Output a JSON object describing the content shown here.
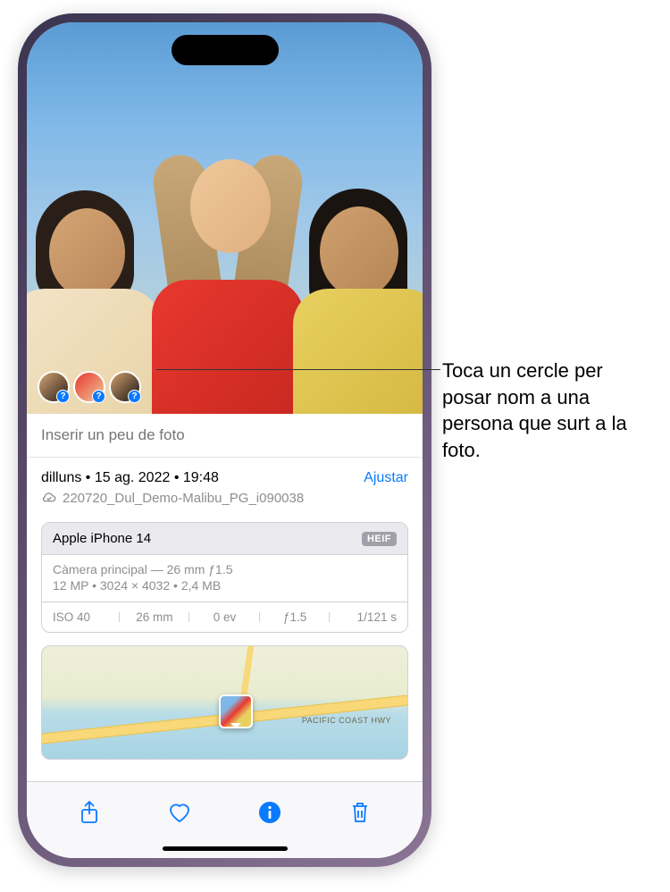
{
  "photo": {
    "caption_placeholder": "Inserir un peu de foto",
    "face_badge_label": "?"
  },
  "info": {
    "date_text": "dilluns • 15 ag. 2022 • 19:48",
    "adjust_label": "Ajustar",
    "filename": "220720_Dul_Demo-Malibu_PG_i090038"
  },
  "metadata": {
    "device": "Apple iPhone 14",
    "format_badge": "HEIF",
    "camera_line": "Càmera principal — 26 mm ƒ1.5",
    "specs_line": "12 MP  •  3024 × 4032  •  2,4 MB",
    "exif": {
      "iso": "ISO 40",
      "focal": "26 mm",
      "ev": "0 ev",
      "aperture": "ƒ1.5",
      "shutter": "1/121 s"
    }
  },
  "map": {
    "road_label": "PACIFIC COAST HWY"
  },
  "toolbar": {
    "share": "share",
    "favorite": "favorite",
    "info": "info",
    "delete": "delete"
  },
  "callout": {
    "text": "Toca un cercle per posar nom a una persona que surt a la foto."
  }
}
